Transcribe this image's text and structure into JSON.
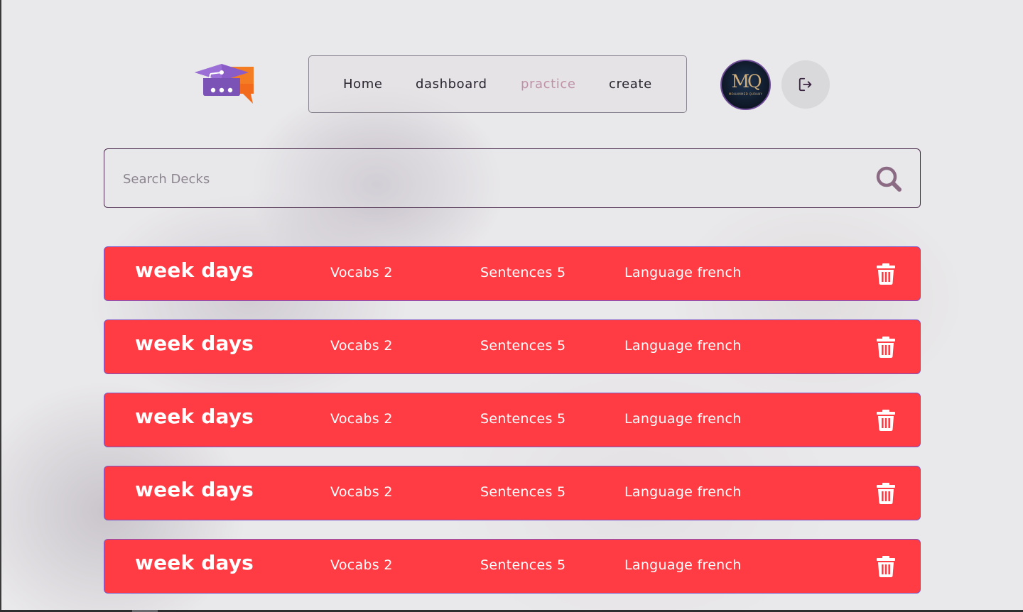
{
  "nav": {
    "items": [
      {
        "label": "Home",
        "active": false
      },
      {
        "label": "dashboard",
        "active": false
      },
      {
        "label": "practice",
        "active": true
      },
      {
        "label": "create",
        "active": false
      }
    ]
  },
  "profile": {
    "monogram": "MQ",
    "name": "MOHAMMED QURANY"
  },
  "search": {
    "placeholder": "Search Decks",
    "value": ""
  },
  "decks": [
    {
      "title": "week days",
      "vocabs": "Vocabs 2",
      "sentences": "Sentences 5",
      "language": "Language french"
    },
    {
      "title": "week days",
      "vocabs": "Vocabs 2",
      "sentences": "Sentences 5",
      "language": "Language french"
    },
    {
      "title": "week days",
      "vocabs": "Vocabs 2",
      "sentences": "Sentences 5",
      "language": "Language french"
    },
    {
      "title": "week days",
      "vocabs": "Vocabs 2",
      "sentences": "Sentences 5",
      "language": "Language french"
    },
    {
      "title": "week days",
      "vocabs": "Vocabs 2",
      "sentences": "Sentences 5",
      "language": "Language french"
    }
  ],
  "colors": {
    "deck_background": "#ff3b44",
    "deck_border": "#7b55c7",
    "nav_active": "#c091a6",
    "brand_purple": "#7b52b6",
    "brand_orange": "#f26a1b"
  },
  "icons": {
    "logo": "graduation-cap-chat-logo",
    "logout": "logout-icon",
    "search": "search-icon",
    "delete": "trash-icon"
  }
}
